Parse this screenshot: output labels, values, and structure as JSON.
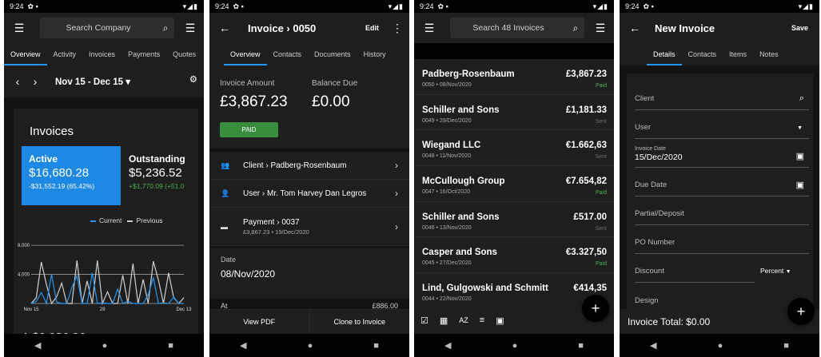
{
  "status": {
    "time": "9:24",
    "icons": "✿ ▪",
    "right": "▾◢▮"
  },
  "nav": {
    "back": "◀",
    "home": "●",
    "recent": "■"
  },
  "screen1": {
    "search_placeholder": "Search Company",
    "tabs": [
      "Overview",
      "Activity",
      "Invoices",
      "Payments",
      "Quotes"
    ],
    "date_range": "Nov 15 - Dec 15",
    "card_title": "Invoices",
    "active": {
      "label": "Active",
      "value": "$16,680.28",
      "delta": "-$31,552.19 (65.42%)"
    },
    "outstanding": {
      "label": "Outstanding",
      "value": "$5,236.52",
      "delta": "+$1,770.09 (+51.0"
    },
    "legend": {
      "current": "Current",
      "previous": "Previous"
    },
    "peek_text": "A   $9,936.96",
    "colors": {
      "active_bg": "#1e88e5",
      "current": "#2196f3",
      "previous": "#cfcfcf"
    },
    "chart_data": {
      "type": "line",
      "x_tick_labels": [
        "Nov 15",
        "29",
        "Dec 13"
      ],
      "y_tick_labels": [
        "0",
        "4,000",
        "8,000"
      ],
      "ylim": [
        0,
        9000
      ],
      "grid": true,
      "legend_position": "top-right",
      "series": [
        {
          "name": "Current",
          "values": [
            0,
            300,
            1500,
            0,
            4000,
            200,
            0,
            0,
            2200,
            3800,
            0,
            0,
            4200,
            0,
            100,
            0,
            0,
            2000,
            0,
            300,
            0,
            0,
            0,
            1200,
            3600,
            0,
            100,
            0,
            900,
            0,
            0
          ]
        },
        {
          "name": "Previous",
          "values": [
            0,
            800,
            5700,
            2600,
            0,
            900,
            2800,
            0,
            0,
            5900,
            0,
            3100,
            0,
            5900,
            0,
            1600,
            0,
            0,
            3900,
            0,
            5500,
            0,
            3300,
            0,
            5800,
            3200,
            0,
            4200,
            800,
            0,
            800
          ]
        }
      ]
    }
  },
  "screen2": {
    "title": "Invoice › 0050",
    "edit": "Edit",
    "tabs": [
      "Overview",
      "Contacts",
      "Documents",
      "History"
    ],
    "invoice_amount_label": "Invoice Amount",
    "invoice_amount": "£3,867.23",
    "balance_due_label": "Balance Due",
    "balance_due": "£0.00",
    "paid_badge": "PAID",
    "client_row": "Client › Padberg-Rosenbaum",
    "user_row": "User › Mr. Tom Harvey Dan Legros",
    "payment_row": "Payment › 0037",
    "payment_sub": "£3,867.23 • 19/Dec/2020",
    "date_label": "Date",
    "date_value": "08/Nov/2020",
    "peek_left": "At",
    "peek_right": "£886.00",
    "view_pdf": "View PDF",
    "clone": "Clone to Invoice"
  },
  "screen3": {
    "search_placeholder": "Search 48 Invoices",
    "invoices": [
      {
        "name": "Padberg-Rosenbaum",
        "meta": "0050 • 08/Nov/2020",
        "amount": "£3,867.23",
        "status": "Paid"
      },
      {
        "name": "Schiller and Sons",
        "meta": "0049 • 29/Dec/2020",
        "amount": "£1,181.33",
        "status": "Sent"
      },
      {
        "name": "Wiegand LLC",
        "meta": "0048 • 11/Nov/2020",
        "amount": "€1.662,63",
        "status": "Sent"
      },
      {
        "name": "McCullough Group",
        "meta": "0047 • 16/Oct/2020",
        "amount": "€7.654,82",
        "status": "Paid"
      },
      {
        "name": "Schiller and Sons",
        "meta": "0046 • 13/Nov/2020",
        "amount": "£517.00",
        "status": "Sent"
      },
      {
        "name": "Casper and Sons",
        "meta": "0045 • 27/Dec/2020",
        "amount": "€3.327,50",
        "status": "Paid"
      },
      {
        "name": "Lind, Gulgowski and Schmitt",
        "meta": "0044 • 22/Nov/2020",
        "amount": "€414,35",
        "status": ""
      }
    ],
    "toolbar_icons": [
      "☑",
      "▦",
      "AZ",
      "≡",
      "▣"
    ],
    "fab": "+"
  },
  "screen4": {
    "title": "New Invoice",
    "save": "Save",
    "tabs": [
      "Details",
      "Contacts",
      "Items",
      "Notes"
    ],
    "fields": {
      "client": "Client",
      "user": "User",
      "invoice_date_label": "Invoice Date",
      "invoice_date": "15/Dec/2020",
      "due_date": "Due Date",
      "partial": "Partial/Deposit",
      "po": "PO Number",
      "discount": "Discount",
      "discount_type": "Percent",
      "design": "Design"
    },
    "total": "Invoice Total: $0.00",
    "fab": "+"
  }
}
